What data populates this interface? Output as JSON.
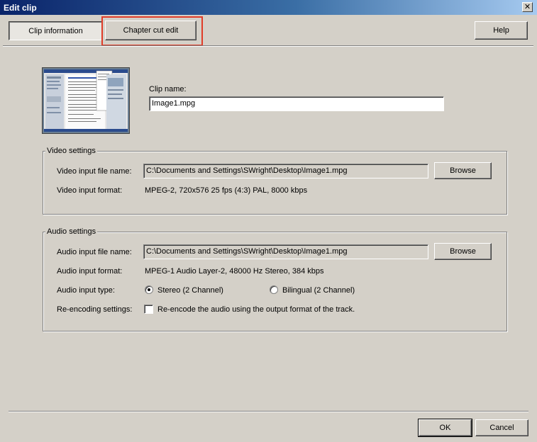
{
  "window": {
    "title": "Edit clip",
    "close_glyph": "✕"
  },
  "tabs": {
    "clip_information": "Clip information",
    "chapter_cut_edit": "Chapter cut edit"
  },
  "help_button": "Help",
  "clip": {
    "name_label": "Clip name:",
    "name_value": "Image1.mpg"
  },
  "video_settings": {
    "legend": "Video settings",
    "input_file_label": "Video input file name:",
    "input_file_value": "C:\\Documents and Settings\\SWright\\Desktop\\Image1.mpg",
    "browse_label": "Browse",
    "input_format_label": "Video input format:",
    "input_format_value": "MPEG-2, 720x576 25 fps (4:3) PAL, 8000 kbps"
  },
  "audio_settings": {
    "legend": "Audio settings",
    "input_file_label": "Audio input file name:",
    "input_file_value": "C:\\Documents and Settings\\SWright\\Desktop\\Image1.mpg",
    "browse_label": "Browse",
    "input_format_label": "Audio input format:",
    "input_format_value": "MPEG-1 Audio Layer-2, 48000 Hz Stereo, 384 kbps",
    "input_type_label": "Audio input type:",
    "type_stereo": "Stereo (2 Channel)",
    "type_bilingual": "Bilingual (2 Channel)",
    "selected_type": "stereo",
    "reencoding_label": "Re-encoding settings:",
    "reencode_checkbox_label": "Re-encode the audio using the output format of the track.",
    "reencode_checked": false
  },
  "footer": {
    "ok_label": "OK",
    "cancel_label": "Cancel"
  },
  "colors": {
    "dialog_bg": "#d4d0c8",
    "title_start": "#0a246a",
    "title_end": "#a6caf0",
    "highlight": "#e03c28"
  }
}
